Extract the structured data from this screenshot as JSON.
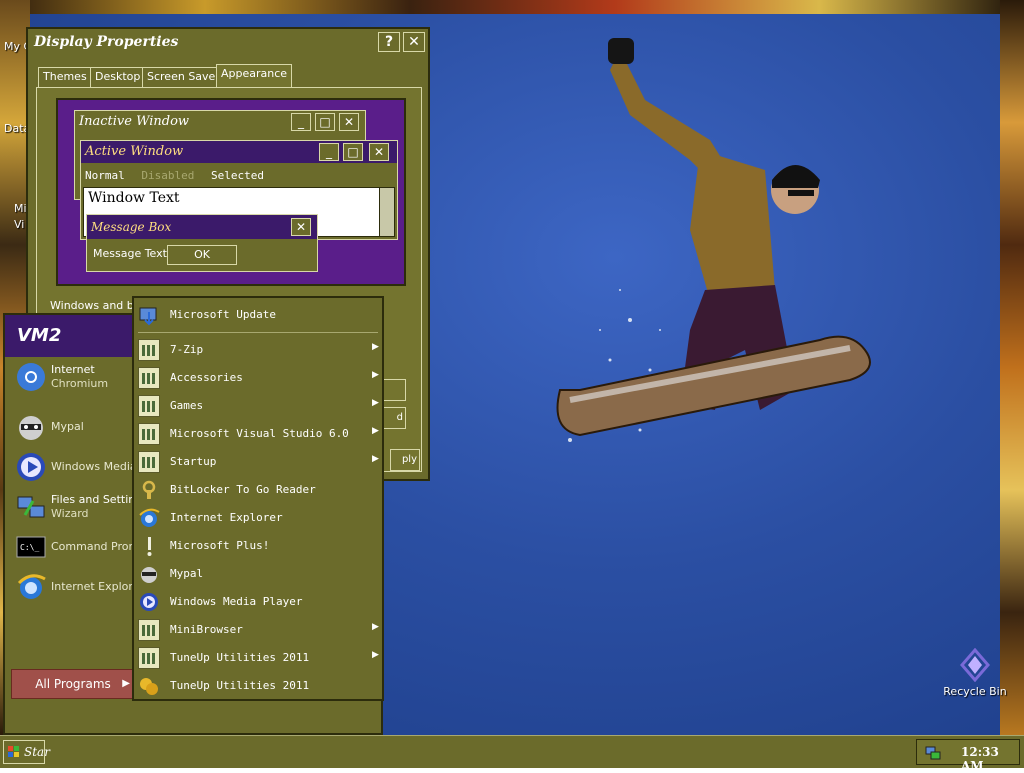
{
  "desktop": {
    "icon_labels": [
      "My C",
      "Data",
      "Mi",
      "Vi"
    ],
    "recycle_bin": "Recycle Bin"
  },
  "display_properties": {
    "title": "Display Properties",
    "help": "?",
    "close": "✕",
    "tabs": [
      "Themes",
      "Desktop",
      "Screen Saver",
      "Appearance"
    ],
    "active_tab": "Appearance",
    "preview": {
      "inactive_title": "Inactive Window",
      "active_title": "Active Window",
      "menu": [
        "Normal",
        "Disabled",
        "Selected"
      ],
      "window_text": "Window Text",
      "message_box_title": "Message Box",
      "message_text": "Message Text",
      "ok": "OK"
    },
    "windows_and_buttons_label": "Windows and bu",
    "partial_buttons": [
      "",
      "d",
      "ply"
    ]
  },
  "start_menu": {
    "user": "VM2",
    "pinned": [
      {
        "l1": "Internet",
        "l2": "Chromium"
      },
      {
        "l0": "Mypal"
      },
      {
        "l0": "Windows Media P"
      },
      {
        "l1": "Files and Setting",
        "l2": "Wizard"
      },
      {
        "l0": "Command Prom"
      },
      {
        "l0": "Internet Explore"
      }
    ],
    "all_programs": "All Programs",
    "all_programs_arrow": "▶"
  },
  "programs": {
    "items": [
      {
        "label": "Microsoft Update",
        "icon": "update-icon",
        "submenu": false
      },
      {
        "label": "7-Zip",
        "icon": "folder-icon",
        "submenu": true
      },
      {
        "label": "Accessories",
        "icon": "folder-icon",
        "submenu": true
      },
      {
        "label": "Games",
        "icon": "folder-icon",
        "submenu": true
      },
      {
        "label": "Microsoft Visual Studio 6.0",
        "icon": "folder-icon",
        "submenu": true
      },
      {
        "label": "Startup",
        "icon": "folder-icon",
        "submenu": true
      },
      {
        "label": "BitLocker To Go Reader",
        "icon": "bitlocker-icon",
        "submenu": false
      },
      {
        "label": "Internet Explorer",
        "icon": "ie-icon",
        "submenu": false
      },
      {
        "label": "Microsoft Plus!",
        "icon": "plus-icon",
        "submenu": false
      },
      {
        "label": "Mypal",
        "icon": "mypal-icon",
        "submenu": false
      },
      {
        "label": "Windows Media Player",
        "icon": "wmp-icon",
        "submenu": false
      },
      {
        "label": "MiniBrowser",
        "icon": "folder-icon",
        "submenu": true
      },
      {
        "label": "TuneUp Utilities 2011",
        "icon": "folder-icon",
        "submenu": true
      },
      {
        "label": "TuneUp Utilities 2011",
        "icon": "tuneup-icon",
        "submenu": false
      }
    ],
    "submenu_arrow": "▶"
  },
  "taskbar": {
    "start_label": "Star",
    "clock": "12:33 AM"
  },
  "colors": {
    "chrome": "#6b6b2b",
    "title_active": "#3b1a6a",
    "preview_bg": "#5a1e8a",
    "all_programs": "#a0504a"
  }
}
